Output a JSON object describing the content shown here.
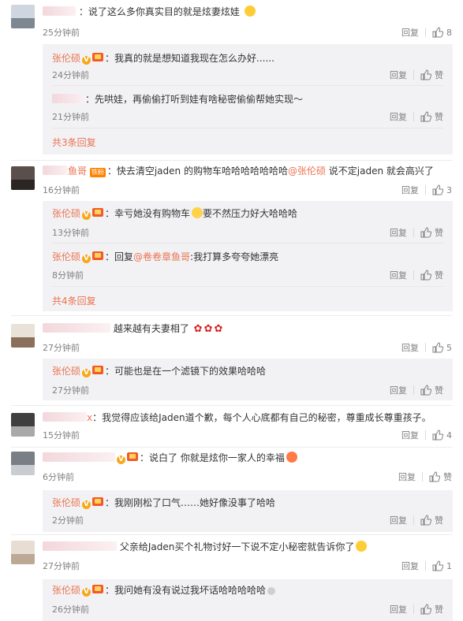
{
  "colors": {
    "link": "#eb7350",
    "muted": "#808080",
    "reply_bg": "#f2f2f5"
  },
  "icons": {
    "like": "thumbs-up-icon",
    "verified": "v-badge-icon",
    "vip": "crown-icon"
  },
  "comments": [
    {
      "text": "：说了这么多你真实目的就是炫妻炫娃",
      "time": "25分钟前",
      "reply": "回复",
      "likes": "8",
      "replies": [
        {
          "author": "张伦硕",
          "text": "：我真的就是想知道我现在怎么办好......",
          "time": "24分钟前",
          "reply": "回复",
          "like": "赞"
        },
        {
          "author": "",
          "text": "：先哄娃，再偷偷打听到娃有啥秘密偷偷帮她实现～",
          "time": "21分钟前",
          "reply": "回复",
          "like": "赞"
        }
      ],
      "more": "共3条回复"
    },
    {
      "name_tail": "鱼哥",
      "fan_badge": "铁粉",
      "text_a": "：快去清空jaden 的购物车哈哈哈哈哈哈哈",
      "mention": "@张伦硕",
      "text_b": " 说不定jaden 就会高兴了",
      "time": "16分钟前",
      "reply": "回复",
      "likes": "3",
      "replies": [
        {
          "author": "张伦硕",
          "text_a": "：幸亏她没有购物车",
          "text_b": "要不然压力好大哈哈哈",
          "time": "13分钟前",
          "reply": "回复",
          "like": "赞"
        },
        {
          "author": "张伦硕",
          "text_a": "：回复",
          "mention": "@卷卷章鱼哥",
          "text_b": ":我打算多夸夸她漂亮",
          "time": "8分钟前",
          "reply": "回复",
          "like": "赞"
        }
      ],
      "more": "共4条回复"
    },
    {
      "text": "越来越有夫妻相了",
      "time": "27分钟前",
      "reply": "回复",
      "likes": "5",
      "replies": [
        {
          "author": "张伦硕",
          "text": "：可能也是在一个滤镜下的效果哈哈哈",
          "time": "27分钟前",
          "reply": "回复",
          "like": "赞"
        }
      ]
    },
    {
      "name_tail": "x",
      "text": "：我觉得应该给Jaden道个歉，每个人心底都有自己的秘密，尊重成长尊重孩子。",
      "time": "15分钟前",
      "reply": "回复",
      "likes": "4"
    },
    {
      "text": "：说白了 你就是炫你一家人的幸福",
      "time": "6分钟前",
      "reply": "回复",
      "like": "赞",
      "replies": [
        {
          "author": "张伦硕",
          "text": "：我刚刚松了口气……她好像没事了哈哈",
          "time": "2分钟前",
          "reply": "回复",
          "like": "赞"
        }
      ]
    },
    {
      "text": "父亲给Jaden买个礼物讨好一下说不定小秘密就告诉你了",
      "time": "27分钟前",
      "reply": "回复",
      "likes": "1",
      "replies": [
        {
          "author": "张伦硕",
          "text": "：我问她有没有说过我坏话哈哈哈哈哈",
          "time": "26分钟前",
          "reply": "回复",
          "like": "赞"
        }
      ]
    }
  ]
}
